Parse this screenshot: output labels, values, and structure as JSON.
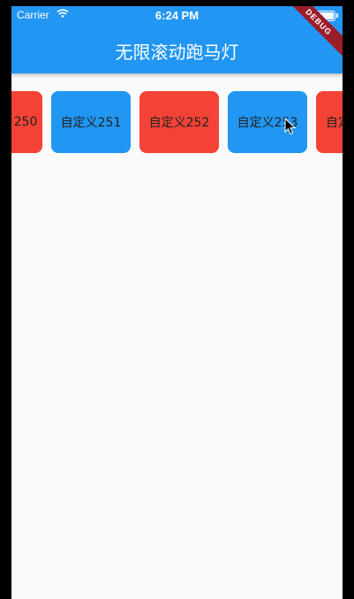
{
  "status_bar": {
    "carrier": "Carrier",
    "time": "6:24 PM"
  },
  "appbar": {
    "title": "无限滚动跑马灯",
    "debug_banner": "DEBUG"
  },
  "marquee": {
    "items": [
      {
        "label": "250",
        "color": "#f44336"
      },
      {
        "label": "自定义251",
        "color": "#2196f3"
      },
      {
        "label": "自定义252",
        "color": "#f44336"
      },
      {
        "label": "自定义253",
        "color": "#2196f3"
      },
      {
        "label": "自定",
        "color": "#f44336"
      }
    ]
  },
  "colors": {
    "appbar": "#2196f3",
    "background": "#fafafa",
    "red": "#f44336",
    "blue": "#2196f3"
  }
}
